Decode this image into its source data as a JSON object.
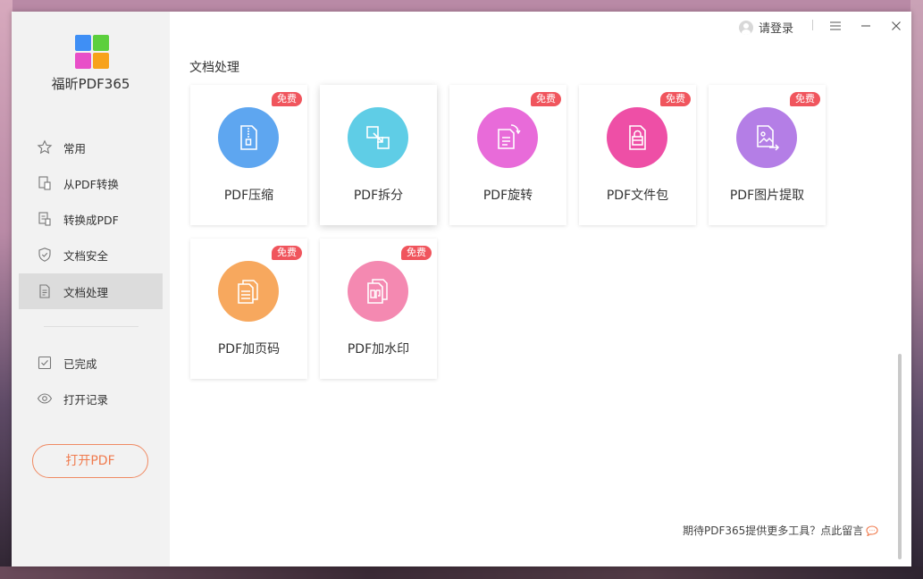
{
  "app": {
    "name": "福昕PDF365"
  },
  "sidebar": {
    "items": [
      {
        "label": "常用",
        "icon": "star-icon"
      },
      {
        "label": "从PDF转换",
        "icon": "from-pdf-icon"
      },
      {
        "label": "转换成PDF",
        "icon": "to-pdf-icon"
      },
      {
        "label": "文档安全",
        "icon": "shield-icon"
      },
      {
        "label": "文档处理",
        "icon": "document-icon",
        "active": true
      },
      {
        "label": "已完成",
        "icon": "checkbox-icon"
      },
      {
        "label": "打开记录",
        "icon": "eye-icon"
      }
    ],
    "open_button": "打开PDF"
  },
  "titlebar": {
    "login": "请登录",
    "menu_icon": "menu-icon",
    "minimize_icon": "minimize-icon",
    "close_icon": "close-icon"
  },
  "main": {
    "section_title": "文档处理",
    "badge_text": "免费",
    "tools": [
      {
        "label": "PDF压缩",
        "color": "#5ea6f0",
        "icon": "zip-file-icon",
        "badge": true
      },
      {
        "label": "PDF拆分",
        "color": "#5fcde6",
        "icon": "split-icon",
        "badge": false
      },
      {
        "label": "PDF旋转",
        "color": "#e86bd9",
        "icon": "rotate-doc-icon",
        "badge": true
      },
      {
        "label": "PDF文件包",
        "color": "#ee4fa6",
        "icon": "package-icon",
        "badge": true
      },
      {
        "label": "PDF图片提取",
        "color": "#b47ee6",
        "icon": "image-extract-icon",
        "badge": true
      },
      {
        "label": "PDF加页码",
        "color": "#f7a85e",
        "icon": "page-number-icon",
        "badge": true
      },
      {
        "label": "PDF加水印",
        "color": "#f489b1",
        "icon": "watermark-icon",
        "badge": true
      }
    ],
    "feedback": "期待PDF365提供更多工具？点此留言"
  },
  "colors": {
    "accent": "#f07a4d",
    "badge": "#f0555d",
    "sidebar_bg": "#f2f2f2",
    "active_bg": "#dcdcdc"
  }
}
